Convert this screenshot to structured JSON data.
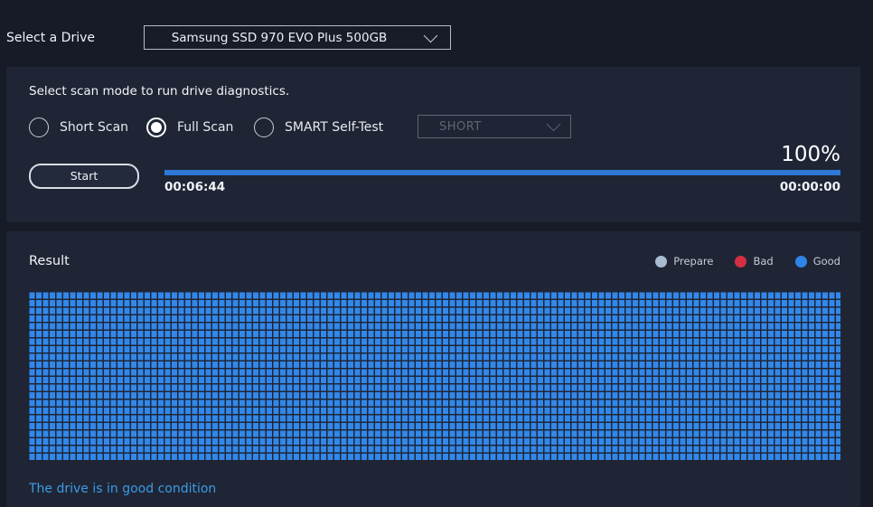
{
  "drive": {
    "label": "Select a Drive",
    "selected": "Samsung SSD 970 EVO Plus 500GB"
  },
  "scan": {
    "title": "Select scan mode to run drive diagnostics.",
    "modes": [
      {
        "label": "Short Scan",
        "checked": false
      },
      {
        "label": "Full Scan",
        "checked": true
      },
      {
        "label": "SMART Self-Test",
        "checked": false
      }
    ],
    "smart_option": "SHORT",
    "start_label": "Start",
    "progress_percent_text": "100%",
    "progress_fraction": 1.0,
    "elapsed": "00:06:44",
    "remaining": "00:00:00"
  },
  "result": {
    "title": "Result",
    "legend": [
      {
        "label": "Prepare",
        "color": "#a9bbd1"
      },
      {
        "label": "Bad",
        "color": "#d32f42"
      },
      {
        "label": "Good",
        "color": "#2f84e6"
      }
    ],
    "block_state": "Good",
    "block_color": "#3288ea",
    "message": "The drive is in good condition"
  }
}
